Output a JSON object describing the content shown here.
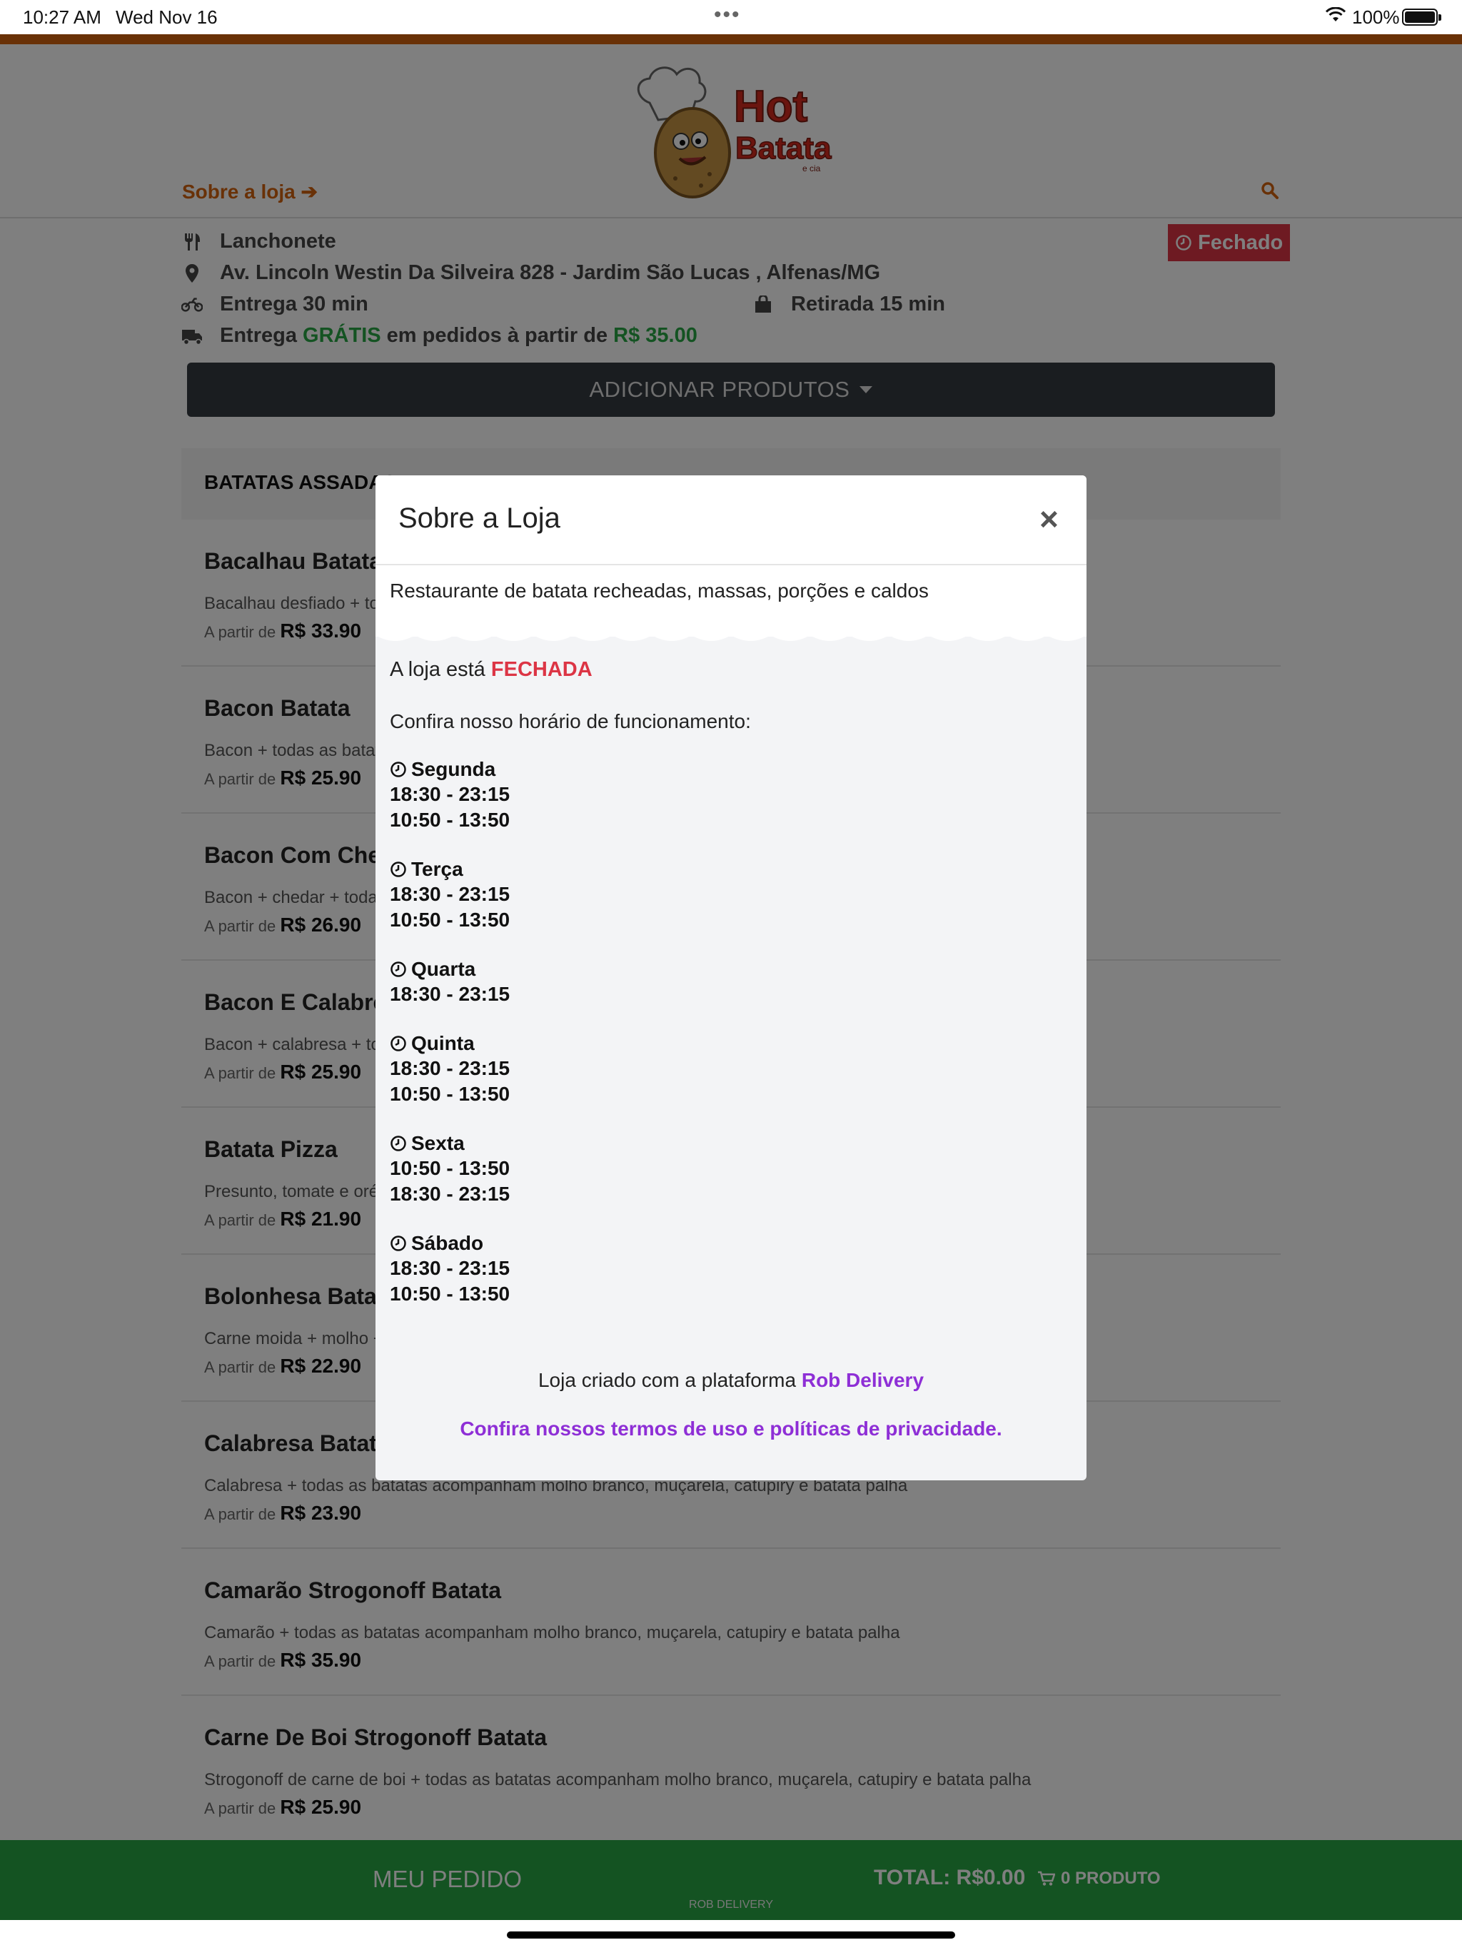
{
  "status_bar": {
    "time": "10:27 AM",
    "date": "Wed Nov 16",
    "battery": "100%"
  },
  "header": {
    "logo_text_1": "Hot",
    "logo_text_2": "Batata",
    "logo_text_3": "e cia",
    "about_link": "Sobre a loja"
  },
  "store": {
    "category": "Lanchonete",
    "address": "Av. Lincoln Westin Da Silveira 828 - Jardim São Lucas , Alfenas/MG",
    "delivery_time": "Entrega 30 min",
    "pickup_time": "Retirada 15 min",
    "free_delivery_prefix": "Entrega",
    "free_delivery_word": "GRÁTIS",
    "free_delivery_middle": "em pedidos à partir de",
    "free_delivery_min": "R$ 35.00",
    "status_badge": "Fechado",
    "brand_color": "#d2620e",
    "closed_color": "#dc3545",
    "free_color": "#28a745"
  },
  "add_products": {
    "label": "ADICIONAR PRODUTOS"
  },
  "category_title": "BATATAS ASSADAS",
  "price_prefix": "A partir de",
  "products": [
    {
      "name": "Bacalhau Batata",
      "desc": "Bacalhau desfiado + todas as batatas acompanham molho branco, muçarela, catupiry e batata palha",
      "price": "R$ 33.90"
    },
    {
      "name": "Bacon Batata",
      "desc": "Bacon + todas as batatas acompanham molho branco, muçarela, catupiry e batata palha",
      "price": "R$ 25.90"
    },
    {
      "name": "Bacon Com Chedar Batata",
      "desc": "Bacon + chedar + todas as batatas acompanham molho branco, muçarela, catupiry e batata palha",
      "price": "R$ 26.90"
    },
    {
      "name": "Bacon E Calabresa Batata",
      "desc": "Bacon + calabresa + todas as batatas acompanham molho branco, muçarela, catupiry e batata palha",
      "price": "R$ 25.90"
    },
    {
      "name": "Batata Pizza",
      "desc": "Presunto, tomate e orégano + todas as batatas acompanham molho branco, muçarela, catupiry e batata palha",
      "price": "R$ 21.90"
    },
    {
      "name": "Bolonhesa Batata",
      "desc": "Carne moida + molho + todas as batatas acompanham molho branco, muçarela, catupiry e batata palha",
      "price": "R$ 22.90"
    },
    {
      "name": "Calabresa Batata",
      "desc": "Calabresa + todas as batatas acompanham molho branco, muçarela, catupiry e batata palha",
      "price": "R$ 23.90"
    },
    {
      "name": "Camarão Strogonoff Batata",
      "desc": "Camarão + todas as batatas acompanham molho branco, muçarela, catupiry e batata palha",
      "price": "R$ 35.90"
    },
    {
      "name": "Carne De Boi Strogonoff Batata",
      "desc": "Strogonoff de carne de boi + todas as batatas acompanham molho branco, muçarela, catupiry e batata palha",
      "price": "R$ 25.90"
    }
  ],
  "footer": {
    "my_order": "MEU PEDIDO",
    "total": "TOTAL: R$0.00",
    "cart": "0 PRODUTO",
    "brand": "ROB DELIVERY",
    "color": "#28a745"
  },
  "modal": {
    "title": "Sobre a Loja",
    "close_glyph": "×",
    "description": "Restaurante de batata recheadas, massas, porções e caldos",
    "status_prefix": "A loja está",
    "status_value": "FECHADA",
    "hours_intro": "Confira nosso horário de funcionamento:",
    "schedule": [
      {
        "day": "Segunda",
        "slots": [
          "18:30 - 23:15",
          "10:50 - 13:50"
        ]
      },
      {
        "day": "Terça",
        "slots": [
          "18:30 - 23:15",
          "10:50 - 13:50"
        ]
      },
      {
        "day": "Quarta",
        "slots": [
          "18:30 - 23:15"
        ]
      },
      {
        "day": "Quinta",
        "slots": [
          "18:30 - 23:15",
          "10:50 - 13:50"
        ]
      },
      {
        "day": "Sexta",
        "slots": [
          "10:50 - 13:50",
          "18:30 - 23:15"
        ]
      },
      {
        "day": "Sábado",
        "slots": [
          "18:30 - 23:15",
          "10:50 - 13:50"
        ]
      }
    ],
    "credit_prefix": "Loja criado com a plataforma",
    "credit_brand": "Rob Delivery",
    "terms_link": "Confira nossos termos de uso e políticas de privacidade.",
    "link_color": "#8e2fd6"
  },
  "icons": {
    "cutlery": "cutlery-icon",
    "location": "map-marker-icon",
    "motorcycle": "motorcycle-icon",
    "bag": "shopping-bag-icon",
    "truck": "truck-icon",
    "clock": "clock-icon",
    "search": "search-icon",
    "arrow": "arrow-right-icon",
    "cart": "cart-icon"
  }
}
